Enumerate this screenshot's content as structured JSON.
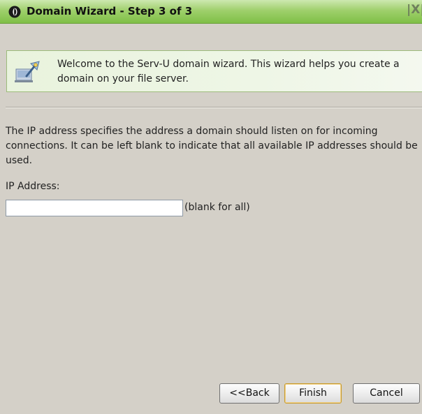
{
  "window": {
    "title": "Domain Wizard - Step 3 of 3",
    "close_label": "|X|"
  },
  "welcome": {
    "text": "Welcome to the Serv-U domain wizard. This wizard helps you create a domain on your file server."
  },
  "description": "The IP address specifies the address a domain should listen on for incoming connections. It can be left blank to indicate that all available IP addresses should be used.",
  "ip_field": {
    "label": "IP Address:",
    "value": "",
    "placeholder": "",
    "hint": "(blank for all)"
  },
  "buttons": {
    "back": "<<Back",
    "finish": "Finish",
    "cancel": "Cancel"
  },
  "colors": {
    "titlebar": "#9fd06c",
    "window_bg": "#d4d0c8",
    "welcome_bg": "#eef6e6"
  }
}
